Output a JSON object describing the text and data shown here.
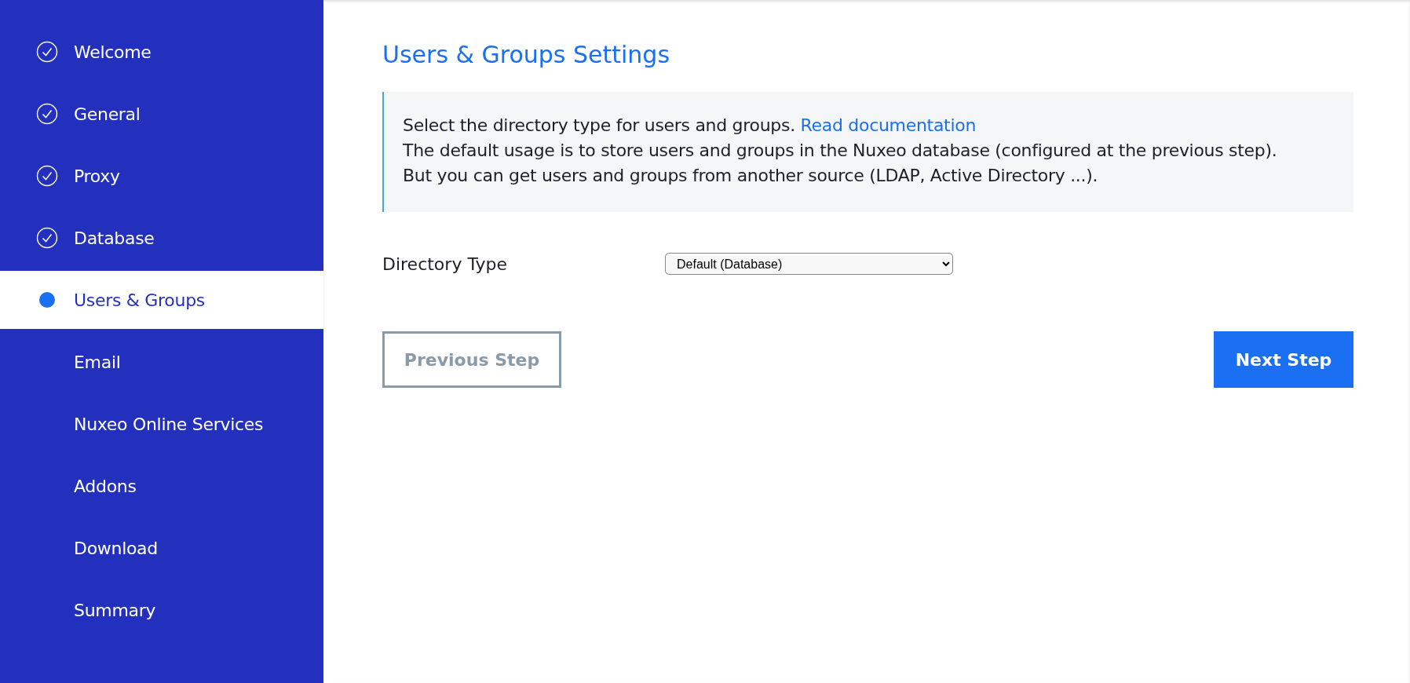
{
  "sidebar": {
    "items": [
      {
        "label": "Welcome",
        "completed": true,
        "selected": false
      },
      {
        "label": "General",
        "completed": true,
        "selected": false
      },
      {
        "label": "Proxy",
        "completed": true,
        "selected": false
      },
      {
        "label": "Database",
        "completed": true,
        "selected": false
      },
      {
        "label": "Users & Groups",
        "completed": false,
        "selected": true
      },
      {
        "label": "Email",
        "completed": false,
        "selected": false
      },
      {
        "label": "Nuxeo Online Services",
        "completed": false,
        "selected": false
      },
      {
        "label": "Addons",
        "completed": false,
        "selected": false
      },
      {
        "label": "Download",
        "completed": false,
        "selected": false
      },
      {
        "label": "Summary",
        "completed": false,
        "selected": false
      }
    ]
  },
  "title": "Users & Groups Settings",
  "info": {
    "intro": "Select the directory type for users and groups.",
    "link": "Read documentation",
    "text": "The default usage is to store users and groups in the Nuxeo database (configured at the previous step). But you can get users and groups from another source (LDAP, Active Directory ...)."
  },
  "directory_type": {
    "label": "Directory Type",
    "value": "Default (Database)"
  },
  "buttons": {
    "previous": "Previous Step",
    "next": "Next Step"
  }
}
